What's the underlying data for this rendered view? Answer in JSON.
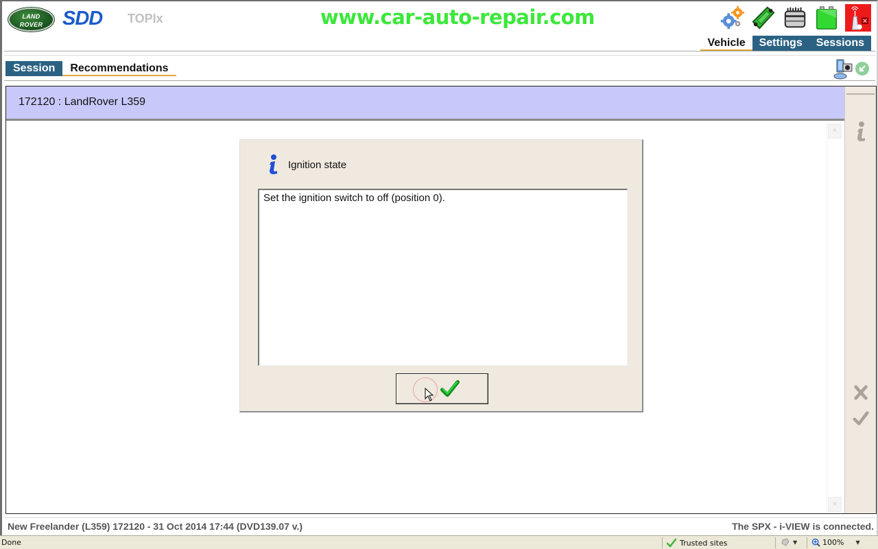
{
  "header": {
    "brand_logo": {
      "line1": "LAND",
      "line2": "ROVER"
    },
    "app_name": "SDD",
    "module_name": "TOPIx",
    "watermark": "www.car-auto-repair.com",
    "toolbar_icons": [
      "settings-gears-icon",
      "vehicle-icon",
      "ecu-module-icon",
      "battery-icon",
      "vci-connection-error-icon"
    ]
  },
  "nav_tabs": [
    {
      "label": "Vehicle",
      "active": true
    },
    {
      "label": "Settings",
      "active": false
    },
    {
      "label": "Sessions",
      "active": false
    }
  ],
  "sub_tabs": [
    {
      "label": "Session",
      "active": true
    },
    {
      "label": "Recommendations",
      "active": false
    }
  ],
  "sub_icons": [
    "screenshot-camera-icon",
    "green-arrow-icon"
  ],
  "main": {
    "title": "172120 : LandRover L359"
  },
  "side_panel": {
    "icons": [
      "info-icon",
      "cancel-icon",
      "confirm-icon"
    ]
  },
  "dialog": {
    "title": "Ignition state",
    "message": "Set the ignition switch to off (position 0).",
    "ok_button": "confirm-checkmark"
  },
  "footer": {
    "left": "New Freelander (L359) 172120 - 31 Oct 2014 17:44 (DVD139.07 v.)",
    "right": "The SPX - i-VIEW is connected."
  },
  "statusbar": {
    "status": "Done",
    "zone": "Trusted sites",
    "zoom": "100%"
  },
  "colors": {
    "tab_blue": "#2b6284",
    "tab_underline": "#e3a53a",
    "title_bar": "#c8c8fa",
    "dialog_bg": "#efe9df",
    "watermark": "#3be83b"
  }
}
